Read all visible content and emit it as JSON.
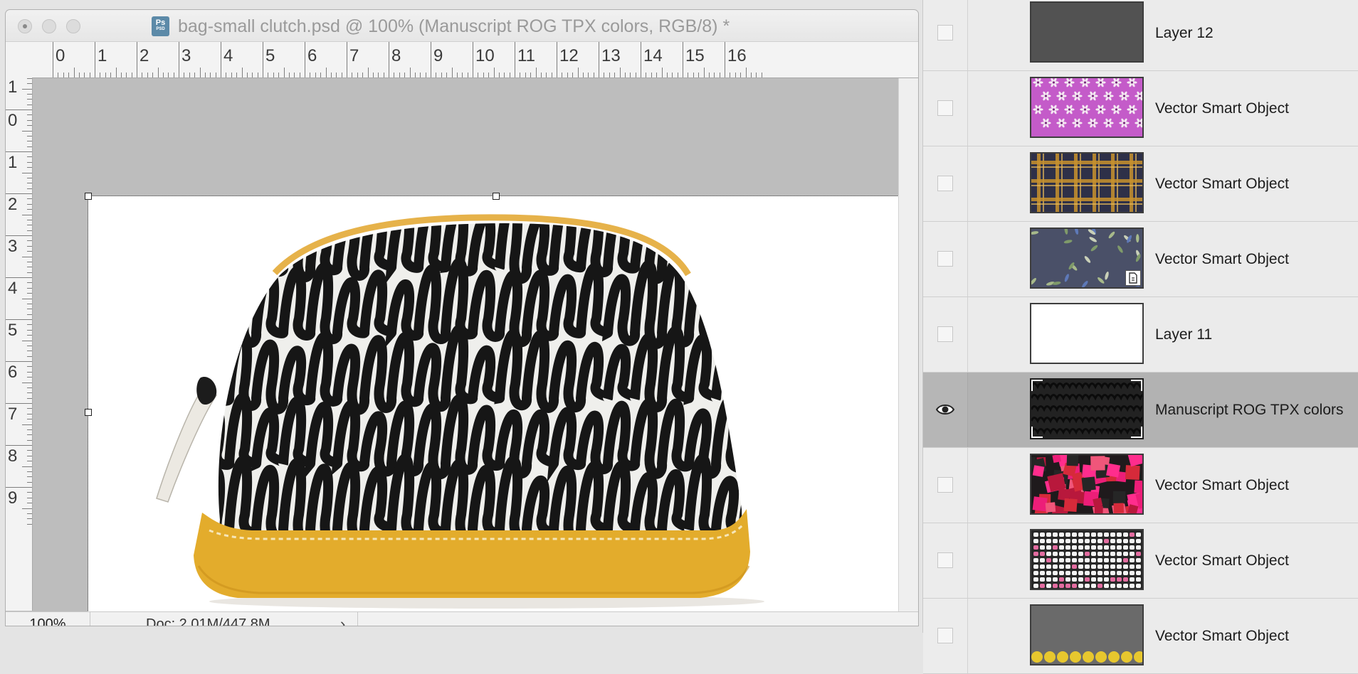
{
  "document": {
    "title": "bag-small clutch.psd @ 100% (Manuscript ROG TPX colors, RGB/8) *",
    "file_icon": {
      "label": "Ps",
      "sublabel": "PSD"
    },
    "zoom": "100%",
    "doc_size": "Doc: 2.01M/447.8M",
    "status_menu_icon": "chevron-right-icon"
  },
  "rulers": {
    "horizontal": [
      "0",
      "1",
      "2",
      "3",
      "4",
      "5",
      "6",
      "7",
      "8",
      "9",
      "10",
      "11",
      "12",
      "13",
      "14",
      "15",
      "16"
    ],
    "vertical": [
      "1",
      "0",
      "1",
      "2",
      "3",
      "4",
      "5",
      "6",
      "7",
      "8",
      "9"
    ]
  },
  "canvas": {
    "subject": "small clutch bag with black scribble pattern and mustard-yellow trim",
    "colors": {
      "pattern": "#161616",
      "fabric": "#eeeeec",
      "trim": "#e3ac2c",
      "background": "#ffffff"
    }
  },
  "layers": [
    {
      "name": "Layer 12",
      "visible": false,
      "selected": false,
      "thumb": "gray"
    },
    {
      "name": "Vector Smart Object",
      "visible": false,
      "selected": false,
      "thumb": "pink-floral"
    },
    {
      "name": "Vector Smart Object",
      "visible": false,
      "selected": false,
      "thumb": "plaid"
    },
    {
      "name": "Vector Smart Object",
      "visible": false,
      "selected": false,
      "thumb": "botanical",
      "smart_badge": true
    },
    {
      "name": "Layer 11",
      "visible": false,
      "selected": false,
      "thumb": "white"
    },
    {
      "name": "Manuscript ROG TPX colors",
      "visible": true,
      "selected": true,
      "thumb": "scribble"
    },
    {
      "name": "Vector Smart Object",
      "visible": false,
      "selected": false,
      "thumb": "pink-squares"
    },
    {
      "name": "Vector Smart Object",
      "visible": false,
      "selected": false,
      "thumb": "dots-rows"
    },
    {
      "name": "Vector Smart Object",
      "visible": false,
      "selected": false,
      "thumb": "yellow-dots"
    }
  ]
}
